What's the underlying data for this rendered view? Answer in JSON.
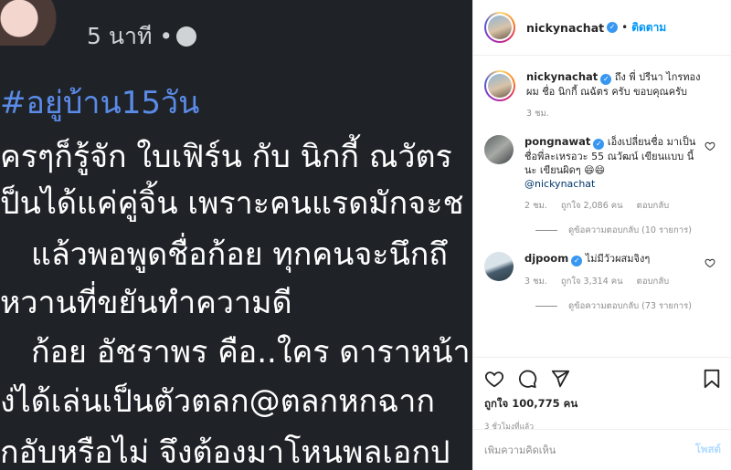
{
  "media": {
    "time_text": "5 นาที •",
    "lines": [
      "#อยู่บ้าน15วัน",
      "ครๆก็รู้จัก ใบเฟิร์น กับ นิกกี้ ณวัตร",
      "ป็นได้แค่คู่จิ้น เพราะคนแรดมักจะช",
      "แล้วพอพูดชื่อก้อย ทุกคนจะนึกถึ",
      "หวานที่ขยันทำความดี",
      "ก้อย อัชราพร คือ..ใคร ดาราหน้า",
      "ง่ได้เล่นเป็นตัวตลก@ตลกหกฉาก",
      "กอับหรือไม่ จึงต้องมาโหนพลเอกป"
    ]
  },
  "header": {
    "username": "nickynachat",
    "follow_label": "ติดตาม"
  },
  "comments": {
    "caption": {
      "username": "nickynachat",
      "text": "ถึง พี่ ปรีนา ไกรทอง ผม ชื่อ นิกกี้ ณฉัตร ครับ ขอบคุณครับ",
      "time": "3 ชม."
    },
    "items": [
      {
        "username": "pongnawat",
        "text": "เอ็งเปลี่ยนชื่อ มาเป็น ชื่อพี่ละเหรอวะ 55 ณวัฒน์ เขียนแบบ นี้นะ เขียนผิดๆ 😄😄",
        "mention": "@nickynachat",
        "time": "2 ชม.",
        "likes": "ถูกใจ 2,086 คน",
        "reply": "ตอบกลับ",
        "view_replies": "ดูข้อความตอบกลับ (10 รายการ)"
      },
      {
        "username": "djpoom",
        "text": "ไม่มีวัวผสมจิงๆ",
        "mention": "",
        "time": "3 ชม.",
        "likes": "ถูกใจ 3,314 คน",
        "reply": "ตอบกลับ",
        "view_replies": "ดูข้อความตอบกลับ (73 รายการ)"
      }
    ]
  },
  "actions": {
    "likes_text": "ถูกใจ 100,775 คน",
    "posted_ago": "3 ชั่วโมงที่แล้ว"
  },
  "add_comment": {
    "placeholder": "เพิ่มความคิดเห็น",
    "post_label": "โพสต์"
  },
  "colors": {
    "accent": "#0095f6",
    "verified": "#3897f0",
    "media_bg": "#1f2328",
    "hashtag": "#5b8be8"
  }
}
